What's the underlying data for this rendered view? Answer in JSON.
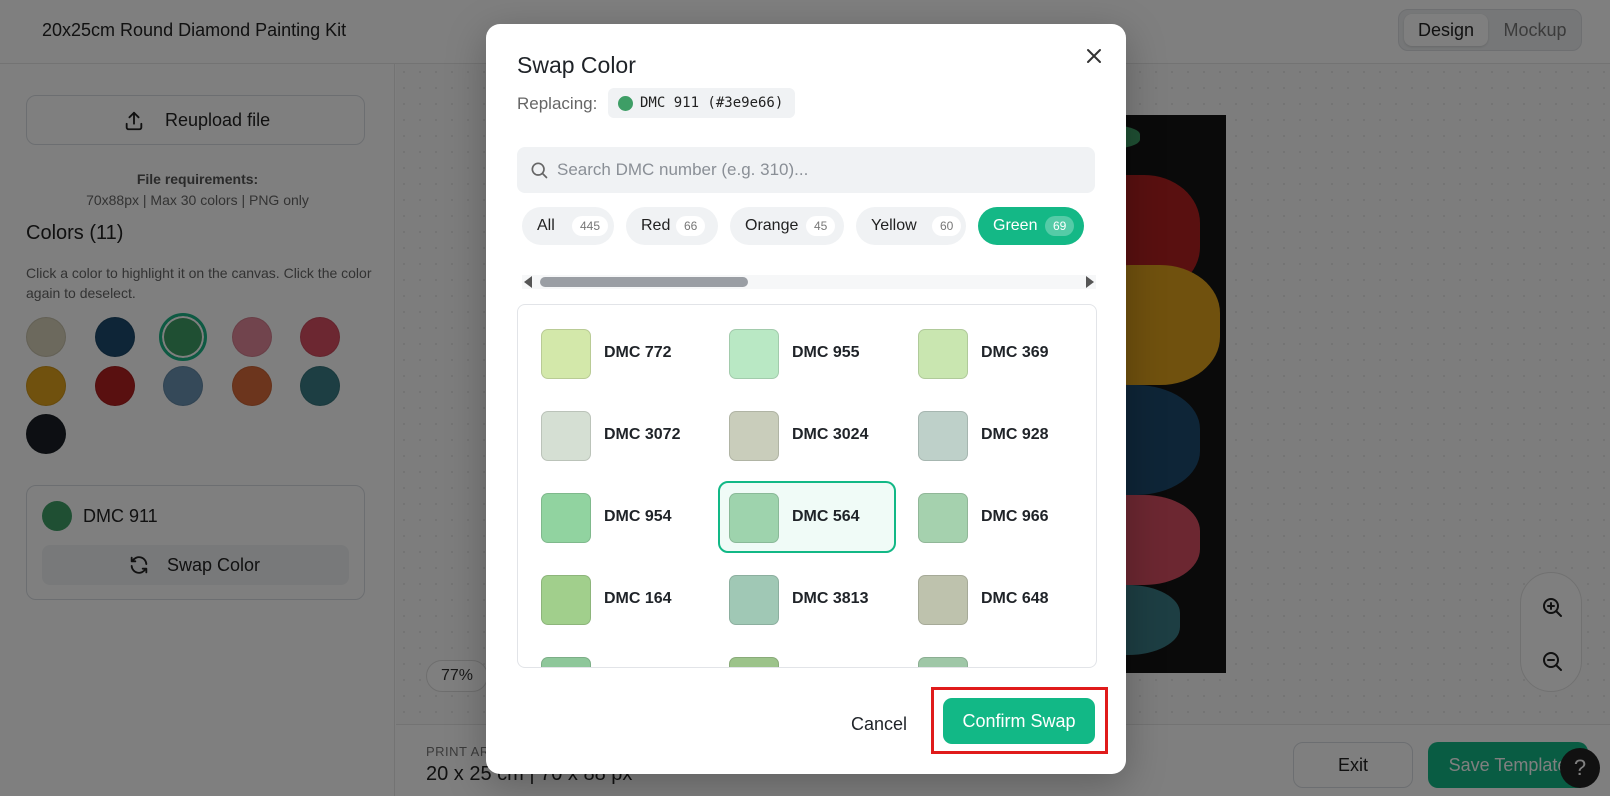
{
  "app": {
    "title": "20x25cm Round Diamond Painting Kit",
    "view_tabs": [
      "Design",
      "Mockup"
    ]
  },
  "sidebar": {
    "reupload_label": "Reupload file",
    "requirements_title": "File requirements:",
    "requirements_text": "70x88px | Max 30 colors | PNG only",
    "colors_title": "Colors (11)",
    "colors_help": "Click a color to highlight it on the canvas. Click the color again to deselect.",
    "palette": [
      "#d8d2ba",
      "#1c4a6e",
      "#3e9e66",
      "#e3889a",
      "#d94f63",
      "#e0a21c",
      "#b32020",
      "#6a92b3",
      "#d96b3a",
      "#3a7d86",
      "#1a1f26"
    ],
    "selected_color": {
      "name": "DMC 911",
      "hex": "#3e9e66"
    },
    "swap_label": "Swap Color"
  },
  "canvas": {
    "zoom": "77%"
  },
  "bottom_bar": {
    "print_label": "PRINT AREA",
    "print_size": "20 x 25 cm  |  70 x 88 px",
    "exit_label": "Exit",
    "save_label": "Save Template",
    "help_label": "?"
  },
  "modal": {
    "title": "Swap Color",
    "replacing_label": "Replacing:",
    "replacing_value": "DMC 911 (#3e9e66)",
    "search_placeholder": "Search DMC number (e.g. 310)...",
    "filters": [
      {
        "label": "All",
        "count": "445",
        "active": false
      },
      {
        "label": "Red",
        "count": "66",
        "active": false
      },
      {
        "label": "Orange",
        "count": "45",
        "active": false
      },
      {
        "label": "Yellow",
        "count": "60",
        "active": false
      },
      {
        "label": "Green",
        "count": "69",
        "active": true
      }
    ],
    "colors": [
      {
        "name": "DMC 772",
        "hex": "#d3e8aa"
      },
      {
        "name": "DMC 955",
        "hex": "#b9e8c4"
      },
      {
        "name": "DMC 369",
        "hex": "#c9e6b0"
      },
      {
        "name": "DMC 3072",
        "hex": "#d5dfd3"
      },
      {
        "name": "DMC 3024",
        "hex": "#c9cdbb"
      },
      {
        "name": "DMC 928",
        "hex": "#bed0c9"
      },
      {
        "name": "DMC 954",
        "hex": "#91d3a0"
      },
      {
        "name": "DMC 564",
        "hex": "#9ed3ad",
        "selected": true
      },
      {
        "name": "DMC 966",
        "hex": "#a5d1ae"
      },
      {
        "name": "DMC 164",
        "hex": "#a1cf8c"
      },
      {
        "name": "DMC 3813",
        "hex": "#a0c8b5"
      },
      {
        "name": "DMC 648",
        "hex": "#bec2ad"
      },
      {
        "name": "",
        "hex": "#8ec79a"
      },
      {
        "name": "",
        "hex": "#9cc38a"
      },
      {
        "name": "",
        "hex": "#9fc7a7"
      }
    ],
    "cancel_label": "Cancel",
    "confirm_label": "Confirm Swap"
  }
}
